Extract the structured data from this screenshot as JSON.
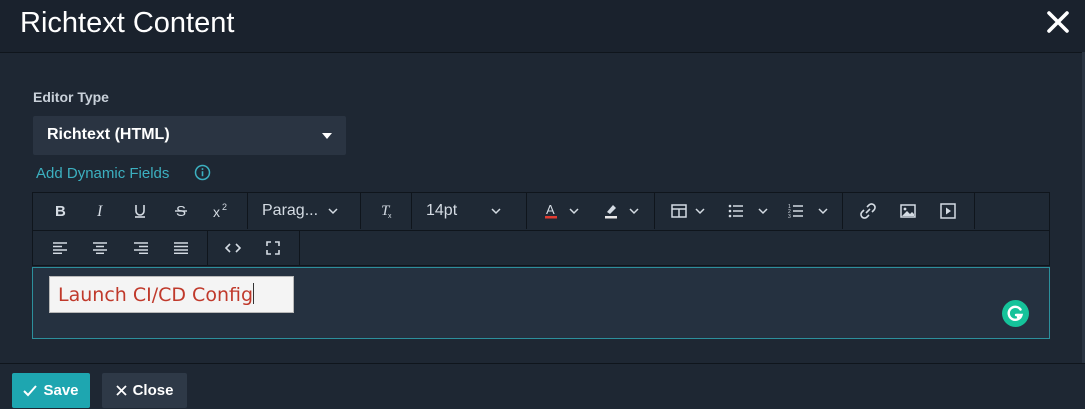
{
  "dialog": {
    "title": "Richtext Content"
  },
  "form": {
    "editor_type_label": "Editor Type",
    "editor_type_value": "Richtext (HTML)",
    "dynamic_fields_label": "Add Dynamic Fields"
  },
  "toolbar": {
    "paragraph_format": "Parag...",
    "font_size": "14pt",
    "icons": [
      "bold-icon",
      "italic-icon",
      "underline-icon",
      "strikethrough-icon",
      "superscript-icon",
      "clear-formatting-icon",
      "text-color-icon",
      "highlight-icon",
      "table-icon",
      "bullet-list-icon",
      "numbered-list-icon",
      "link-icon",
      "image-icon",
      "media-icon",
      "align-left-icon",
      "align-center-icon",
      "align-right-icon",
      "justify-icon",
      "source-code-icon",
      "fullscreen-icon"
    ]
  },
  "editor": {
    "content": "Launch CI/CD Config"
  },
  "footer": {
    "save_label": "Save",
    "close_label": "Close"
  },
  "colors": {
    "accent": "#1ea6b0",
    "link": "#3cb0c0",
    "content_text": "#c0392b",
    "grammarly": "#15c39a"
  }
}
